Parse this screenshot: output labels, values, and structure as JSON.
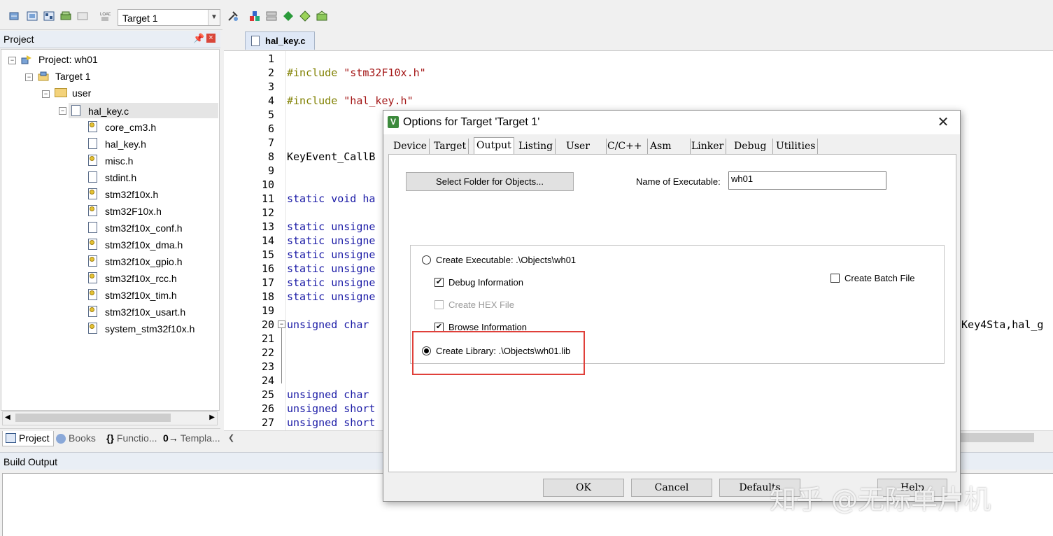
{
  "toolbar": {
    "target_select": "Target 1",
    "icons": [
      "translate-icon",
      "build-icon",
      "rebuild-icon",
      "batch-build-icon",
      "stop-build-icon",
      "download-icon",
      "target-options-icon",
      "manage-components-icon",
      "pack-installer-icon",
      "select-packs-icon",
      "manage-rte-icon"
    ]
  },
  "project_panel": {
    "title": "Project",
    "tree": [
      {
        "label": "Project: wh01",
        "type": "project"
      },
      {
        "label": "Target 1",
        "type": "target"
      },
      {
        "label": "user",
        "type": "folder"
      },
      {
        "label": "hal_key.c",
        "type": "file",
        "selected": true
      },
      {
        "label": "core_cm3.h",
        "type": "header"
      },
      {
        "label": "hal_key.h",
        "type": "header"
      },
      {
        "label": "misc.h",
        "type": "header"
      },
      {
        "label": "stdint.h",
        "type": "header"
      },
      {
        "label": "stm32f10x.h",
        "type": "header"
      },
      {
        "label": "stm32F10x.h",
        "type": "header"
      },
      {
        "label": "stm32f10x_conf.h",
        "type": "header"
      },
      {
        "label": "stm32f10x_dma.h",
        "type": "header"
      },
      {
        "label": "stm32f10x_gpio.h",
        "type": "header"
      },
      {
        "label": "stm32f10x_rcc.h",
        "type": "header"
      },
      {
        "label": "stm32f10x_tim.h",
        "type": "header"
      },
      {
        "label": "stm32f10x_usart.h",
        "type": "header"
      },
      {
        "label": "system_stm32f10x.h",
        "type": "header"
      }
    ],
    "bottom_tabs": [
      "Project",
      "Books",
      "Functio...",
      "Templa..."
    ]
  },
  "editor": {
    "tab": "hal_key.c",
    "lines": [
      {
        "n": "1",
        "text": ""
      },
      {
        "n": "2",
        "text": "#include \"stm32F10x.h\""
      },
      {
        "n": "3",
        "text": ""
      },
      {
        "n": "4",
        "text": "#include \"hal_key.h\""
      },
      {
        "n": "5",
        "text": ""
      },
      {
        "n": "6",
        "text": ""
      },
      {
        "n": "7",
        "text": ""
      },
      {
        "n": "8",
        "text": "KeyEvent_CallB"
      },
      {
        "n": "9",
        "text": ""
      },
      {
        "n": "10",
        "text": ""
      },
      {
        "n": "11",
        "text": "static void ha"
      },
      {
        "n": "12",
        "text": ""
      },
      {
        "n": "13",
        "text": "static unsigne"
      },
      {
        "n": "14",
        "text": "static unsigne"
      },
      {
        "n": "15",
        "text": "static unsigne"
      },
      {
        "n": "16",
        "text": "static unsigne"
      },
      {
        "n": "17",
        "text": "static unsigne"
      },
      {
        "n": "18",
        "text": "static unsigne"
      },
      {
        "n": "19",
        "text": ""
      },
      {
        "n": "20",
        "text": "unsigned char"
      },
      {
        "n": "21",
        "text": ""
      },
      {
        "n": "22",
        "text": ""
      },
      {
        "n": "23",
        "text": ""
      },
      {
        "n": "24",
        "text": ""
      },
      {
        "n": "25",
        "text": "unsigned char"
      },
      {
        "n": "26",
        "text": "unsigned short"
      },
      {
        "n": "27",
        "text": "unsigned short"
      }
    ],
    "line20_tail": "tKey4Sta,hal_g"
  },
  "build_output": {
    "title": "Build Output"
  },
  "dialog": {
    "title": "Options for Target 'Target 1'",
    "tabs": [
      "Device",
      "Target",
      "Output",
      "Listing",
      "User",
      "C/C++",
      "Asm",
      "Linker",
      "Debug",
      "Utilities"
    ],
    "active_tab": "Output",
    "select_folder_button": "Select Folder for Objects...",
    "name_of_executable_label": "Name of Executable:",
    "name_of_executable_value": "wh01",
    "create_executable_label": "Create Executable:  .\\Objects\\wh01",
    "debug_information_label": "Debug Information",
    "debug_information_checked": true,
    "create_hex_label": "Create HEX File",
    "create_hex_checked": false,
    "browse_information_label": "Browse Information",
    "browse_information_checked": true,
    "create_library_label": "Create Library:  .\\Objects\\wh01.lib",
    "create_library_selected": true,
    "create_batch_label": "Create Batch File",
    "create_batch_checked": false,
    "buttons": {
      "ok": "OK",
      "cancel": "Cancel",
      "defaults": "Defaults",
      "help": "Help"
    }
  },
  "watermark": "知乎 @无际单片机",
  "colors": {
    "highlight": "#e0403a",
    "keyword": "#1a1aa6",
    "preprocessor": "#808000",
    "string": "#a31515"
  }
}
